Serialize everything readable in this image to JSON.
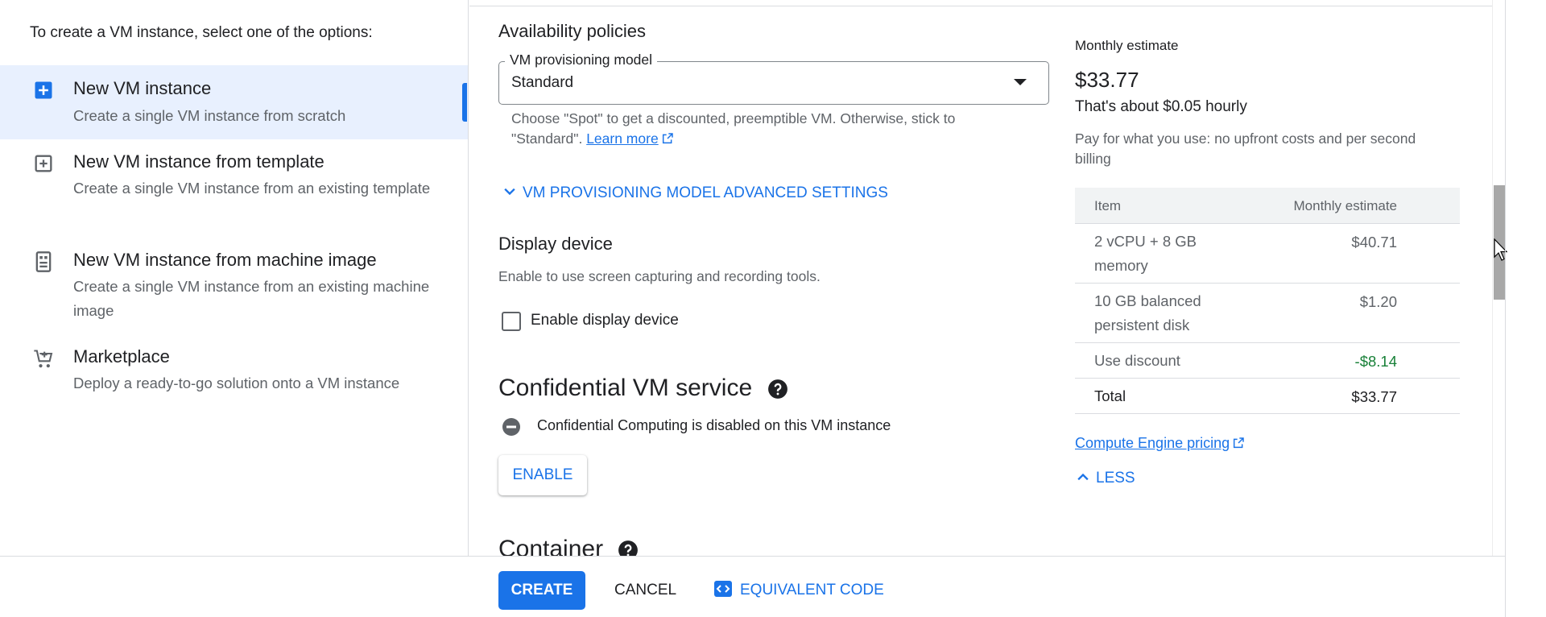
{
  "left_panel": {
    "intro": "To create a VM instance, select one of the options:",
    "options": [
      {
        "title": "New VM instance",
        "description": "Create a single VM instance from scratch",
        "icon": "add-box-icon",
        "selected": true
      },
      {
        "title": "New VM instance from template",
        "description": "Create a single VM instance from an existing template",
        "icon": "add-box-outline-icon",
        "selected": false
      },
      {
        "title": "New VM instance from machine image",
        "description": "Create a single VM instance from an existing machine image",
        "icon": "machine-image-icon",
        "selected": false
      },
      {
        "title": "Marketplace",
        "description": "Deploy a ready-to-go solution onto a VM instance",
        "icon": "cart-icon",
        "selected": false
      }
    ]
  },
  "main": {
    "availability": {
      "title": "Availability policies",
      "provisioning_label": "VM provisioning model",
      "provisioning_value": "Standard",
      "help_text": "Choose \"Spot\" to get a discounted, preemptible VM. Otherwise, stick to \"Standard\".",
      "learn_more": "Learn more",
      "advanced_settings": "VM PROVISIONING MODEL ADVANCED SETTINGS"
    },
    "display_device": {
      "title": "Display device",
      "description": "Enable to use screen capturing and recording tools.",
      "checkbox_label": "Enable display device",
      "checked": false
    },
    "confidential": {
      "title": "Confidential VM service",
      "status": "Confidential Computing is disabled on this VM instance",
      "enable_button": "ENABLE"
    },
    "container": {
      "title": "Container"
    }
  },
  "estimate": {
    "heading": "Monthly estimate",
    "amount": "$33.77",
    "hourly": "That's about $0.05 hourly",
    "note": "Pay for what you use: no upfront costs and per second billing",
    "columns": [
      "Item",
      "Monthly estimate"
    ],
    "rows": [
      {
        "item": "2 vCPU + 8 GB memory",
        "cost": "$40.71"
      },
      {
        "item": "10 GB balanced persistent disk",
        "cost": "$1.20"
      },
      {
        "item": "Use discount",
        "cost": "-$8.14"
      },
      {
        "item": "Total",
        "cost": "$33.77"
      }
    ],
    "pricing_link": "Compute Engine pricing",
    "less": "LESS"
  },
  "actions": {
    "create": "CREATE",
    "cancel": "CANCEL",
    "equivalent_code": "EQUIVALENT CODE"
  },
  "colors": {
    "accent": "#1a73e8",
    "selected_bg": "#e8f0fe",
    "discount_green": "#188038"
  }
}
